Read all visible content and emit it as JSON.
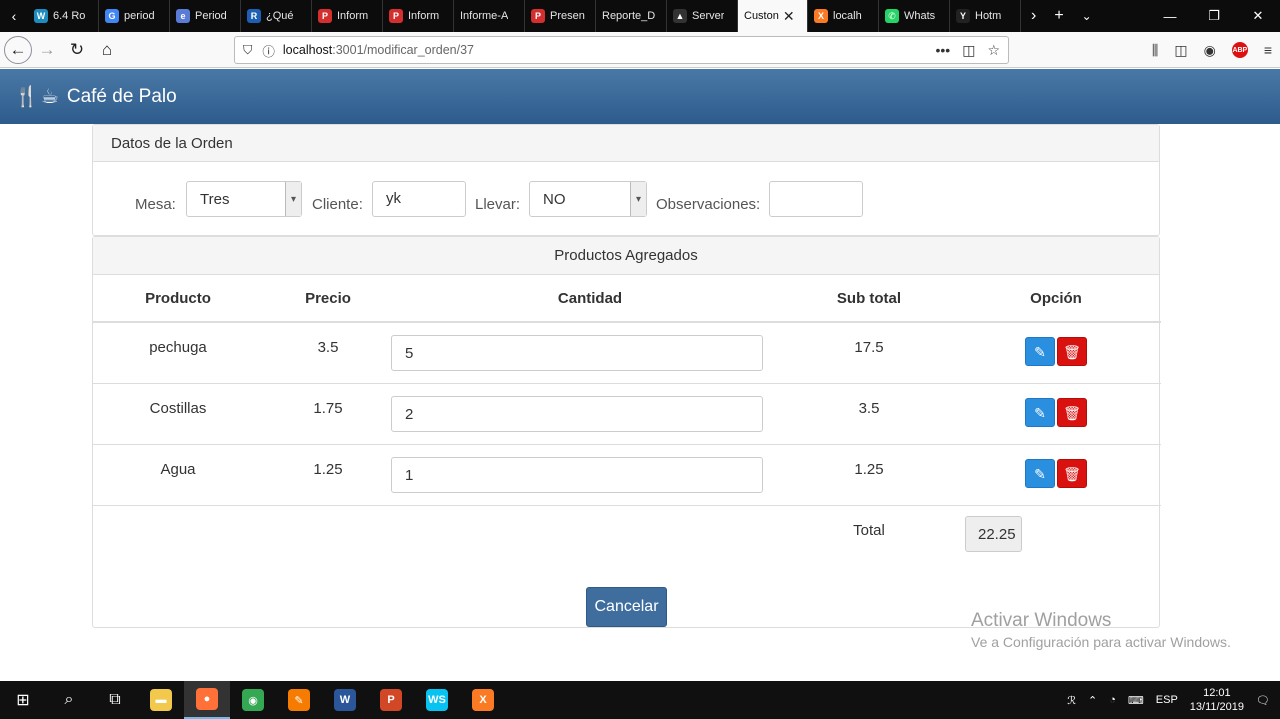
{
  "browser": {
    "tabs": [
      {
        "label": "6.4 Ro",
        "icon": "wordpress-icon",
        "color": "#1e8cbe",
        "glyph": "W"
      },
      {
        "label": "period",
        "icon": "google-icon",
        "color": "#4285f4",
        "glyph": "G"
      },
      {
        "label": "Period",
        "icon": "period-icon",
        "color": "#5a7bd6",
        "glyph": "e"
      },
      {
        "label": "¿Qué",
        "icon": "r-icon",
        "color": "#1e5fb3",
        "glyph": "R"
      },
      {
        "label": "Inform",
        "icon": "pdf-icon",
        "color": "#d32f2f",
        "glyph": "P"
      },
      {
        "label": "Inform",
        "icon": "pdf-icon",
        "color": "#d32f2f",
        "glyph": "P"
      },
      {
        "label": "Informe-A",
        "icon": "",
        "color": "",
        "glyph": ""
      },
      {
        "label": "Presen",
        "icon": "pdf-icon",
        "color": "#d32f2f",
        "glyph": "P"
      },
      {
        "label": "Reporte_D",
        "icon": "",
        "color": "",
        "glyph": ""
      },
      {
        "label": "Server",
        "icon": "warning-icon",
        "color": "#333333",
        "glyph": "▲"
      },
      {
        "label": "Custon",
        "icon": "",
        "color": "",
        "glyph": "",
        "active": true
      },
      {
        "label": "localh",
        "icon": "xampp-icon",
        "color": "#fb7a24",
        "glyph": "X"
      },
      {
        "label": "Whats",
        "icon": "whatsapp-icon",
        "color": "#25d366",
        "glyph": "✆"
      },
      {
        "label": "Hotm",
        "icon": "hotmail-icon",
        "color": "#222222",
        "glyph": "Y"
      }
    ],
    "url_host": "localhost",
    "url_path": ":3001/modificar_orden/37"
  },
  "app": {
    "brand": "Café de Palo"
  },
  "order": {
    "heading": "Datos de la Orden",
    "mesa_label": "Mesa:",
    "mesa_value": "Tres",
    "cliente_label": "Cliente:",
    "cliente_value": "yk",
    "llevar_label": "Llevar:",
    "llevar_value": "NO",
    "observaciones_label": "Observaciones:",
    "observaciones_value": ""
  },
  "products": {
    "heading": "Productos Agregados",
    "columns": [
      "Producto",
      "Precio",
      "Cantidad",
      "Sub total",
      "Opción"
    ],
    "rows": [
      {
        "producto": "pechuga",
        "precio": "3.5",
        "cantidad": "5",
        "subtotal": "17.5"
      },
      {
        "producto": "Costillas",
        "precio": "1.75",
        "cantidad": "2",
        "subtotal": "3.5"
      },
      {
        "producto": "Agua",
        "precio": "1.25",
        "cantidad": "1",
        "subtotal": "1.25"
      }
    ],
    "total_label": "Total",
    "total_value": "22.25",
    "cancel_label": "Cancelar"
  },
  "watermark": {
    "line1": "Activar Windows",
    "line2": "Ve a Configuración para activar Windows."
  },
  "taskbar": {
    "apps": [
      {
        "name": "file-explorer-icon",
        "color": "#f2c94c",
        "glyph": "▬"
      },
      {
        "name": "firefox-icon",
        "color": "#ff7139",
        "glyph": "●",
        "active": true
      },
      {
        "name": "chrome-icon",
        "color": "#34a853",
        "glyph": "◉"
      },
      {
        "name": "paint-icon",
        "color": "#f57c00",
        "glyph": "✎"
      },
      {
        "name": "word-icon",
        "color": "#2b579a",
        "glyph": "W"
      },
      {
        "name": "powerpoint-icon",
        "color": "#d24726",
        "glyph": "P"
      },
      {
        "name": "webstorm-icon",
        "color": "#07c3f2",
        "glyph": "WS"
      },
      {
        "name": "xampp-icon",
        "color": "#fb7a24",
        "glyph": "X"
      }
    ],
    "language": "ESP",
    "time": "12:01",
    "date": "13/11/2019"
  }
}
